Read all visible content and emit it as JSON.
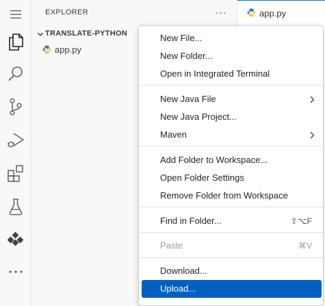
{
  "activity_bar": {
    "items": [
      {
        "icon": "menu-icon"
      },
      {
        "icon": "files-icon"
      },
      {
        "icon": "search-icon"
      },
      {
        "icon": "source-control-icon"
      },
      {
        "icon": "run-debug-icon"
      },
      {
        "icon": "extensions-icon"
      },
      {
        "icon": "testing-icon"
      },
      {
        "icon": "java-projects-icon"
      },
      {
        "icon": "more-icon"
      }
    ]
  },
  "explorer": {
    "title": "EXPLORER",
    "more_label": "···",
    "folder_name": "TRANSLATE-PYTHON",
    "files": [
      {
        "name": "app.py",
        "icon": "python-file-icon"
      }
    ]
  },
  "editor": {
    "tabs": [
      {
        "label": "app.py",
        "icon": "python-file-icon",
        "active": true
      }
    ]
  },
  "context_menu": {
    "groups": [
      [
        {
          "label": "New File..."
        },
        {
          "label": "New Folder..."
        },
        {
          "label": "Open in Integrated Terminal"
        }
      ],
      [
        {
          "label": "New Java File",
          "submenu": true
        },
        {
          "label": "New Java Project..."
        },
        {
          "label": "Maven",
          "submenu": true
        }
      ],
      [
        {
          "label": "Add Folder to Workspace..."
        },
        {
          "label": "Open Folder Settings"
        },
        {
          "label": "Remove Folder from Workspace"
        }
      ],
      [
        {
          "label": "Find in Folder...",
          "shortcut": "⇧⌥F"
        }
      ],
      [
        {
          "label": "Paste",
          "shortcut": "⌘V",
          "disabled": true
        }
      ],
      [
        {
          "label": "Download..."
        },
        {
          "label": "Upload...",
          "selected": true
        }
      ]
    ]
  },
  "colors": {
    "accent": "#0060c0",
    "python_blue": "#3b77a8",
    "python_yellow": "#f2c94c"
  }
}
